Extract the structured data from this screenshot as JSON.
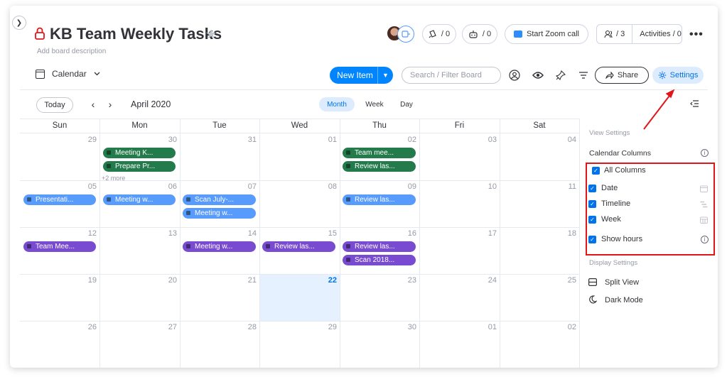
{
  "header": {
    "title": "KB Team Weekly Tasks",
    "description": "Add board description",
    "counter_updates": "/ 0",
    "counter_integrations": "/ 0",
    "zoom_label": "Start Zoom call",
    "persons_count": "/ 3",
    "activities_label": "Activities / 0",
    "more_label": "•••"
  },
  "toolbar": {
    "view_label": "Calendar",
    "new_item_label": "New Item",
    "search_placeholder": "Search / Filter Board",
    "share_label": "Share",
    "settings_label": "Settings"
  },
  "calendar_nav": {
    "today_label": "Today",
    "prev_label": "‹",
    "next_label": "›",
    "month_label": "April 2020",
    "tabs": [
      "Month",
      "Week",
      "Day"
    ],
    "active_tab": "Month"
  },
  "calendar": {
    "weekdays": [
      "Sun",
      "Mon",
      "Tue",
      "Wed",
      "Thu",
      "Fri",
      "Sat"
    ],
    "weeks": [
      [
        "29",
        "30",
        "31",
        "01",
        "02",
        "03",
        "04"
      ],
      [
        "05",
        "06",
        "07",
        "08",
        "09",
        "10",
        "11"
      ],
      [
        "12",
        "13",
        "14",
        "15",
        "16",
        "17",
        "18"
      ],
      [
        "19",
        "20",
        "21",
        "22",
        "23",
        "24",
        "25"
      ],
      [
        "26",
        "27",
        "28",
        "29",
        "30",
        "01",
        "02"
      ]
    ],
    "today": "22",
    "more_label": "+2 more",
    "events": [
      {
        "label": "Meeting K...",
        "color": "#237a4a"
      },
      {
        "label": "Prepare Pr...",
        "color": "#237a4a"
      },
      {
        "label": "Team mee...",
        "color": "#237a4a"
      },
      {
        "label": "Review las...",
        "color": "#237a4a"
      },
      {
        "label": "Presentati...",
        "color": "#579bfc"
      },
      {
        "label": "Meeting w...",
        "color": "#579bfc"
      },
      {
        "label": "Scan July-...",
        "color": "#579bfc"
      },
      {
        "label": "Meeting w...",
        "color": "#579bfc"
      },
      {
        "label": "Review las...",
        "color": "#579bfc"
      },
      {
        "label": "Team Mee...",
        "color": "#784bd1"
      },
      {
        "label": "Meeting w...",
        "color": "#784bd1"
      },
      {
        "label": "Review las...",
        "color": "#784bd1"
      },
      {
        "label": "Review las...",
        "color": "#784bd1"
      },
      {
        "label": "Scan 2018...",
        "color": "#784bd1"
      }
    ]
  },
  "settings_panel": {
    "view_settings_heading": "View Settings",
    "calendar_columns_label": "Calendar Columns",
    "options": [
      {
        "label": "All Columns",
        "checked": true
      },
      {
        "label": "Date",
        "checked": true
      },
      {
        "label": "Timeline",
        "checked": true
      },
      {
        "label": "Week",
        "checked": true
      },
      {
        "label": "Show hours",
        "checked": true
      }
    ],
    "display_settings_heading": "Display Settings",
    "split_view_label": "Split View",
    "dark_mode_label": "Dark Mode"
  },
  "colors": {
    "accent": "#0073ea",
    "primary_button": "#0085ff",
    "highlight_box": "#e0161b"
  }
}
